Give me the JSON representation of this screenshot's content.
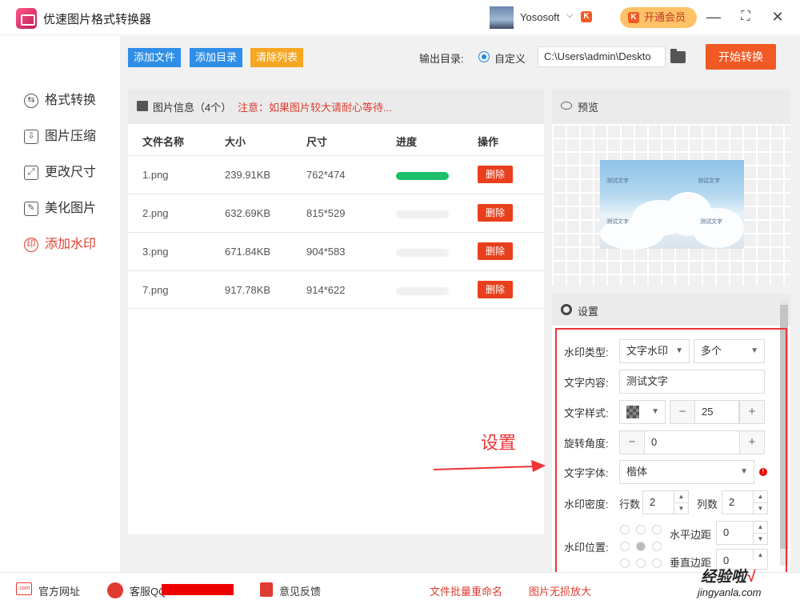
{
  "app": {
    "title": "优速图片格式转换器"
  },
  "user": {
    "name": "Yososoft",
    "badge": "K"
  },
  "vip": {
    "label": "开通会员",
    "badge": "K"
  },
  "window": {
    "minimize": "—",
    "maximize": "⛶",
    "close": "✕"
  },
  "sidebar": {
    "items": [
      {
        "label": "格式转换",
        "icon": "⇆"
      },
      {
        "label": "图片压缩",
        "icon": "⇩"
      },
      {
        "label": "更改尺寸",
        "icon": "⤢"
      },
      {
        "label": "美化图片",
        "icon": "✎"
      },
      {
        "label": "添加水印",
        "icon": "印"
      }
    ]
  },
  "toolbar": {
    "add_file": "添加文件",
    "add_dir": "添加目录",
    "clear_list": "清除列表",
    "output_label": "输出目录:",
    "output_option": "自定义",
    "output_path": "C:\\Users\\admin\\Deskto",
    "start": "开始转换"
  },
  "files": {
    "info": "图片信息（4个）",
    "warning": "注意：如果图片较大请耐心等待...",
    "headers": [
      "文件名称",
      "大小",
      "尺寸",
      "进度",
      "操作"
    ],
    "delete_label": "删除",
    "rows": [
      {
        "name": "1.png",
        "size": "239.91KB",
        "dims": "762*474",
        "progress": 1.0
      },
      {
        "name": "2.png",
        "size": "632.69KB",
        "dims": "815*529",
        "progress": 0
      },
      {
        "name": "3.png",
        "size": "671.84KB",
        "dims": "904*583",
        "progress": 0
      },
      {
        "name": "7.png",
        "size": "917.78KB",
        "dims": "914*622",
        "progress": 0
      }
    ]
  },
  "preview": {
    "title": "预览",
    "watermark": "测试文字"
  },
  "settings": {
    "title": "设置",
    "type_label": "水印类型:",
    "type_value": "文字水印",
    "count_value": "多个",
    "content_label": "文字内容:",
    "content_value": "测试文字",
    "style_label": "文字样式:",
    "style_size": "25",
    "angle_label": "旋转角度:",
    "angle_value": "0",
    "font_label": "文字字体:",
    "font_value": "楷体",
    "density_label": "水印密度:",
    "rows_label": "行数",
    "rows_value": "2",
    "cols_label": "列数",
    "cols_value": "2",
    "position_label": "水印位置:",
    "hmargin_label": "水平边距",
    "hmargin_value": "0",
    "vmargin_label": "垂直边距",
    "vmargin_value": "0"
  },
  "annotation": {
    "text": "设置",
    "color": "#ee3333"
  },
  "footer": {
    "website": "官方网址",
    "qq": "客服QQ",
    "feedback": "意见反馈",
    "rename": "文件批量重命名",
    "enlarge": "图片无损放大"
  },
  "watermark_logo": {
    "text": "经验啦",
    "check": "√",
    "url": "jingyanla.com"
  }
}
